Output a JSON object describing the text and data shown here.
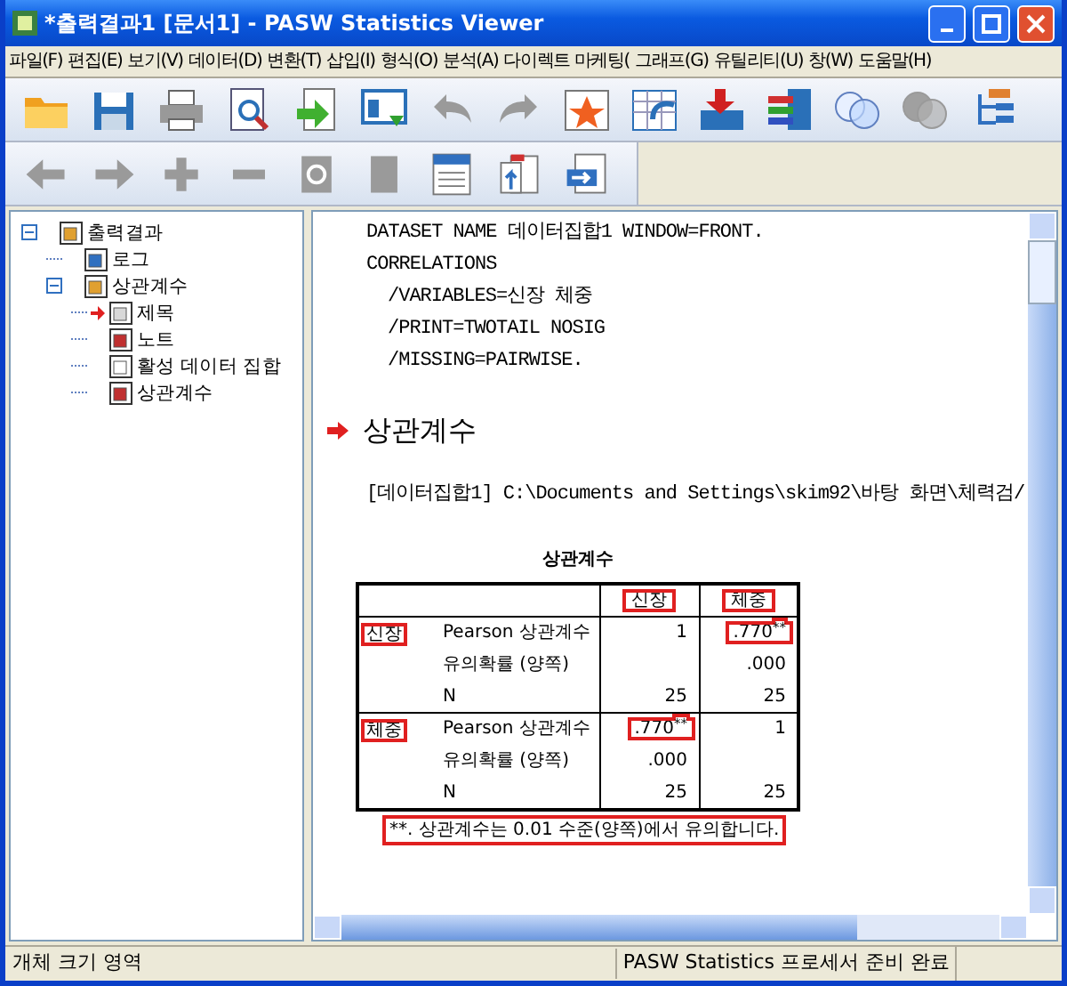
{
  "window": {
    "title": "*출력결과1 [문서1] - PASW Statistics Viewer"
  },
  "menu": [
    "파일(F)",
    "편집(E)",
    "보기(V)",
    "데이터(D)",
    "변환(T)",
    "삽입(I)",
    "형식(O)",
    "분석(A)",
    "다이렉트 마케팅(",
    "그래프(G)",
    "유틸리티(U)",
    "창(W)",
    "도움말(H)"
  ],
  "toolbar_1": [
    {
      "kind": "open",
      "disabled": false
    },
    {
      "kind": "save",
      "disabled": false
    },
    {
      "kind": "print",
      "disabled": false
    },
    {
      "kind": "preview",
      "disabled": false
    },
    {
      "kind": "export",
      "disabled": false
    },
    {
      "kind": "recall",
      "disabled": false
    },
    {
      "kind": "undo",
      "disabled": true
    },
    {
      "kind": "redo",
      "disabled": true
    },
    {
      "kind": "star",
      "disabled": false
    },
    {
      "kind": "gotocase",
      "disabled": false
    },
    {
      "kind": "insert",
      "disabled": false
    },
    {
      "kind": "variables",
      "disabled": false
    },
    {
      "kind": "circles",
      "disabled": false
    },
    {
      "kind": "circles",
      "disabled": true
    },
    {
      "kind": "tree",
      "disabled": false
    }
  ],
  "toolbar_2": [
    {
      "kind": "back",
      "disabled": true
    },
    {
      "kind": "forward",
      "disabled": true
    },
    {
      "kind": "plus",
      "disabled": true
    },
    {
      "kind": "minus",
      "disabled": true
    },
    {
      "kind": "show",
      "disabled": true
    },
    {
      "kind": "hide",
      "disabled": true
    },
    {
      "kind": "heading",
      "disabled": false
    },
    {
      "kind": "title",
      "disabled": false
    },
    {
      "kind": "text",
      "disabled": false
    }
  ],
  "outline": [
    {
      "label": "출력결과",
      "kind": "book",
      "expanded": true,
      "current": false,
      "children": [
        {
          "label": "로그",
          "kind": "log",
          "current": false
        },
        {
          "label": "상관계수",
          "kind": "book",
          "expanded": true,
          "current": false,
          "children": [
            {
              "label": "제목",
              "kind": "title",
              "current": true
            },
            {
              "label": "노트",
              "kind": "note",
              "current": false
            },
            {
              "label": "활성 데이터 집합",
              "kind": "text",
              "current": false
            },
            {
              "label": "상관계수",
              "kind": "table",
              "current": false
            }
          ]
        }
      ]
    }
  ],
  "output": {
    "syntax": [
      {
        "text": "DATASET NAME 데이터집합1 WINDOW=FRONT.",
        "indent": false
      },
      {
        "text": "CORRELATIONS",
        "indent": false
      },
      {
        "text": "/VARIABLES=신장 체중",
        "indent": true
      },
      {
        "text": "/PRINT=TWOTAIL NOSIG",
        "indent": true
      },
      {
        "text": "/MISSING=PAIRWISE.",
        "indent": true
      }
    ],
    "heading": "상관계수",
    "dataset_path": "[데이터집합1] C:\\Documents and Settings\\skim92\\바탕 화면\\체력검/",
    "table": {
      "title": "상관계수",
      "columns": [
        {
          "text": "신장",
          "highlighted": true
        },
        {
          "text": "체중",
          "highlighted": true
        }
      ],
      "groups": [
        {
          "variable": {
            "text": "신장",
            "highlighted": true
          },
          "rows": [
            {
              "stat": "Pearson 상관계수",
              "cells": [
                {
                  "text": "1",
                  "highlighted": false
                },
                {
                  "text": ".770$^{**}$",
                  "highlighted": true
                }
              ]
            },
            {
              "stat": "유의확률 (양쪽)",
              "cells": [
                null,
                {
                  "text": ".000",
                  "highlighted": false
                }
              ]
            },
            {
              "stat": "N",
              "cells": [
                {
                  "text": "25",
                  "highlighted": false
                },
                {
                  "text": "25",
                  "highlighted": false
                }
              ]
            }
          ]
        },
        {
          "variable": {
            "text": "체중",
            "highlighted": true
          },
          "rows": [
            {
              "stat": "Pearson 상관계수",
              "cells": [
                {
                  "text": ".770$^{**}$",
                  "highlighted": true
                },
                {
                  "text": "1",
                  "highlighted": false
                }
              ]
            },
            {
              "stat": "유의확률 (양쪽)",
              "cells": [
                {
                  "text": ".000",
                  "highlighted": false
                },
                null
              ]
            },
            {
              "stat": "N",
              "cells": [
                {
                  "text": "25",
                  "highlighted": false
                },
                {
                  "text": "25",
                  "highlighted": false
                }
              ]
            }
          ]
        }
      ],
      "footnote": {
        "text": "**. 상관계수는 0.01 수준(양쪽)에서 유의합니다.",
        "highlighted": true
      }
    }
  },
  "status_bar": [
    "개체 크기 영역",
    "PASW Statistics 프로세서 준비 완료"
  ]
}
